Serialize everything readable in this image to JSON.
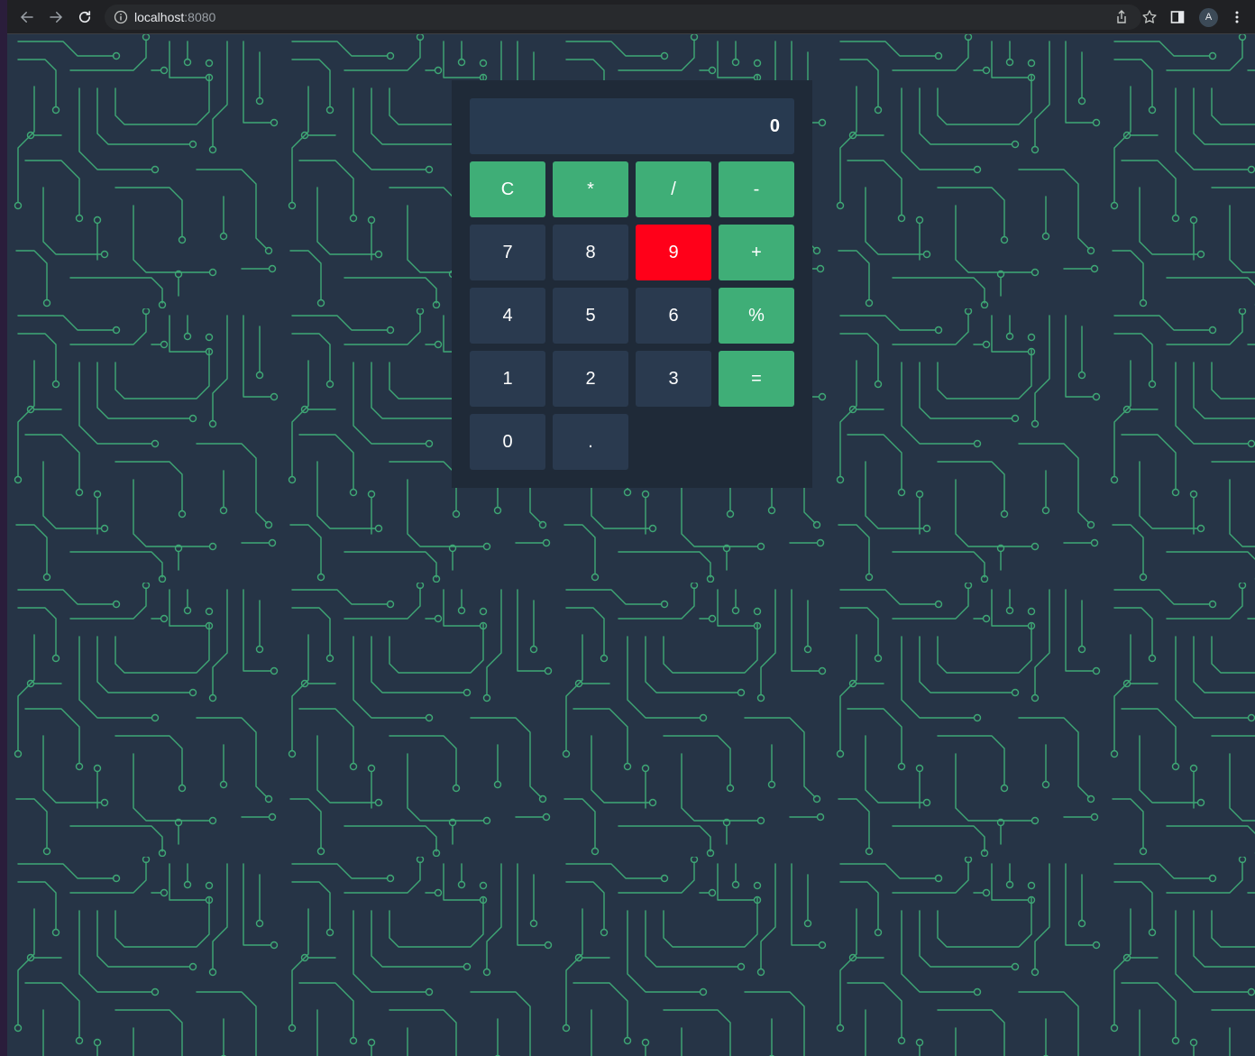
{
  "browser": {
    "url_host": "localhost",
    "url_port": ":8080",
    "profile_initial": "A"
  },
  "calculator": {
    "display": "0",
    "keys": [
      {
        "label": "C",
        "kind": "op",
        "name": "clear-button"
      },
      {
        "label": "*",
        "kind": "op",
        "name": "multiply-button"
      },
      {
        "label": "/",
        "kind": "op",
        "name": "divide-button"
      },
      {
        "label": "-",
        "kind": "op",
        "name": "subtract-button"
      },
      {
        "label": "7",
        "kind": "num",
        "name": "digit-7-button"
      },
      {
        "label": "8",
        "kind": "num",
        "name": "digit-8-button"
      },
      {
        "label": "9",
        "kind": "hot",
        "name": "digit-9-button"
      },
      {
        "label": "+",
        "kind": "op",
        "name": "add-button"
      },
      {
        "label": "4",
        "kind": "num",
        "name": "digit-4-button"
      },
      {
        "label": "5",
        "kind": "num",
        "name": "digit-5-button"
      },
      {
        "label": "6",
        "kind": "num",
        "name": "digit-6-button"
      },
      {
        "label": "%",
        "kind": "op",
        "name": "percent-button"
      },
      {
        "label": "1",
        "kind": "num",
        "name": "digit-1-button"
      },
      {
        "label": "2",
        "kind": "num",
        "name": "digit-2-button"
      },
      {
        "label": "3",
        "kind": "num",
        "name": "digit-3-button"
      },
      {
        "label": "=",
        "kind": "op",
        "name": "equals-button"
      },
      {
        "label": "0",
        "kind": "num",
        "name": "digit-0-button"
      },
      {
        "label": ".",
        "kind": "num",
        "name": "decimal-button"
      }
    ]
  },
  "colors": {
    "page_background": "#263446",
    "circuit_trace": "#3fae77",
    "calculator_panel": "#1f2a38",
    "operator_key": "#3fae77",
    "number_key": "#2a3a4f",
    "highlight_key": "#ff0019"
  }
}
